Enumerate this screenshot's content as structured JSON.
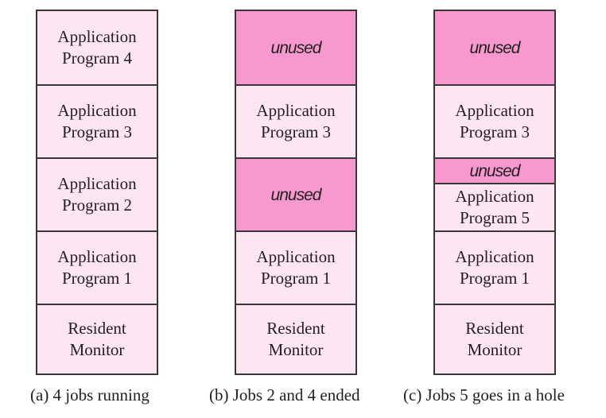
{
  "colors": {
    "used_fill": "#fde6f1",
    "unused_fill": "#f799cf",
    "border": "#3a3537"
  },
  "columns": [
    {
      "caption": "(a) 4 jobs running",
      "segments": [
        {
          "label": "Application\nProgram 4",
          "state": "used"
        },
        {
          "label": "Application\nProgram 3",
          "state": "used"
        },
        {
          "label": "Application\nProgram 2",
          "state": "used"
        },
        {
          "label": "Application\nProgram 1",
          "state": "used"
        },
        {
          "label": "Resident\nMonitor",
          "state": "used"
        }
      ]
    },
    {
      "caption": "(b) Jobs 2 and 4 ended",
      "segments": [
        {
          "label": "unused",
          "state": "unused"
        },
        {
          "label": "Application\nProgram 3",
          "state": "used"
        },
        {
          "label": "unused",
          "state": "unused"
        },
        {
          "label": "Application\nProgram 1",
          "state": "used"
        },
        {
          "label": "Resident\nMonitor",
          "state": "used"
        }
      ]
    },
    {
      "caption": "(c) Jobs 5 goes in a hole",
      "segments": [
        {
          "label": "unused",
          "state": "unused"
        },
        {
          "label": "Application\nProgram 3",
          "state": "used"
        },
        {
          "label": "unused",
          "state": "unused"
        },
        {
          "label": "Application\nProgram 5",
          "state": "used"
        },
        {
          "label": "Application\nProgram 1",
          "state": "used"
        },
        {
          "label": "Resident\nMonitor",
          "state": "used"
        }
      ]
    }
  ]
}
